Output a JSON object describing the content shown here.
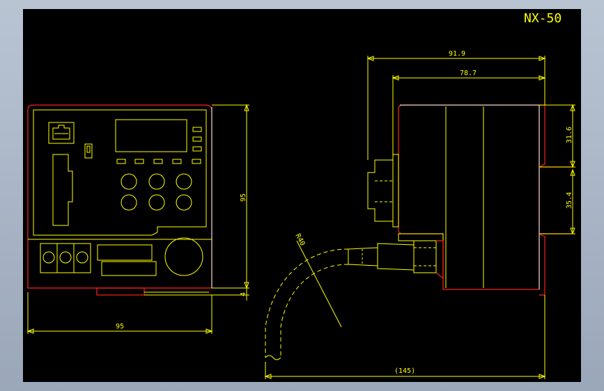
{
  "title": "NX-50",
  "dimensions": {
    "front_width": "95",
    "front_height": "95",
    "base_offset": "4",
    "side_total": "91.9",
    "side_body": "78.7",
    "upper_section": "31.6",
    "lower_section": "35.4",
    "cable_length": "(145)",
    "bend_radius": "R40"
  },
  "colors": {
    "background": "#000000",
    "outline": "#ff2020",
    "detail": "#ffff00",
    "edge": "#ffffff",
    "frame": "#a7b3c4"
  }
}
